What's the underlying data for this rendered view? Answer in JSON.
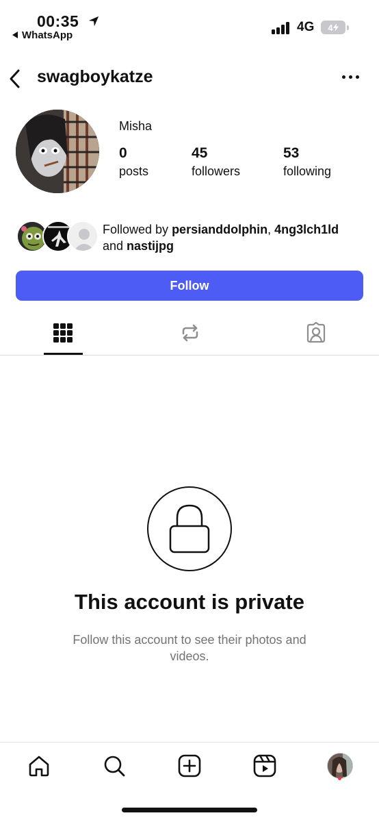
{
  "status_bar": {
    "time": "00:35",
    "back_app": "WhatsApp",
    "network": "4G",
    "battery": "4",
    "icons": [
      "location-arrow-icon",
      "signal-icon",
      "battery-icon"
    ]
  },
  "header": {
    "username": "swagboykatze",
    "icons": [
      "back-chevron-icon",
      "more-options-icon"
    ]
  },
  "profile": {
    "display_name": "Misha",
    "stats": [
      {
        "value": "0",
        "label": "posts"
      },
      {
        "value": "45",
        "label": "followers"
      },
      {
        "value": "53",
        "label": "following"
      }
    ],
    "followed_by": {
      "prefix": "Followed by ",
      "user1": "persianddolphin",
      "sep": ", ",
      "user2": "4ng3lch1ld",
      "mid": "and ",
      "user3": "nastijpg"
    },
    "follow_button": "Follow"
  },
  "tabs": [
    "grid-icon",
    "reposts-icon",
    "tagged-icon"
  ],
  "private": {
    "title": "This account is private",
    "subtitle": "Follow this account to see their photos and videos."
  },
  "bottom_nav": [
    "home-icon",
    "search-icon",
    "create-icon",
    "reels-icon",
    "profile-avatar"
  ],
  "colors": {
    "accent": "#4c5cf4",
    "muted_text": "#737373",
    "notification": "#ff3040"
  }
}
